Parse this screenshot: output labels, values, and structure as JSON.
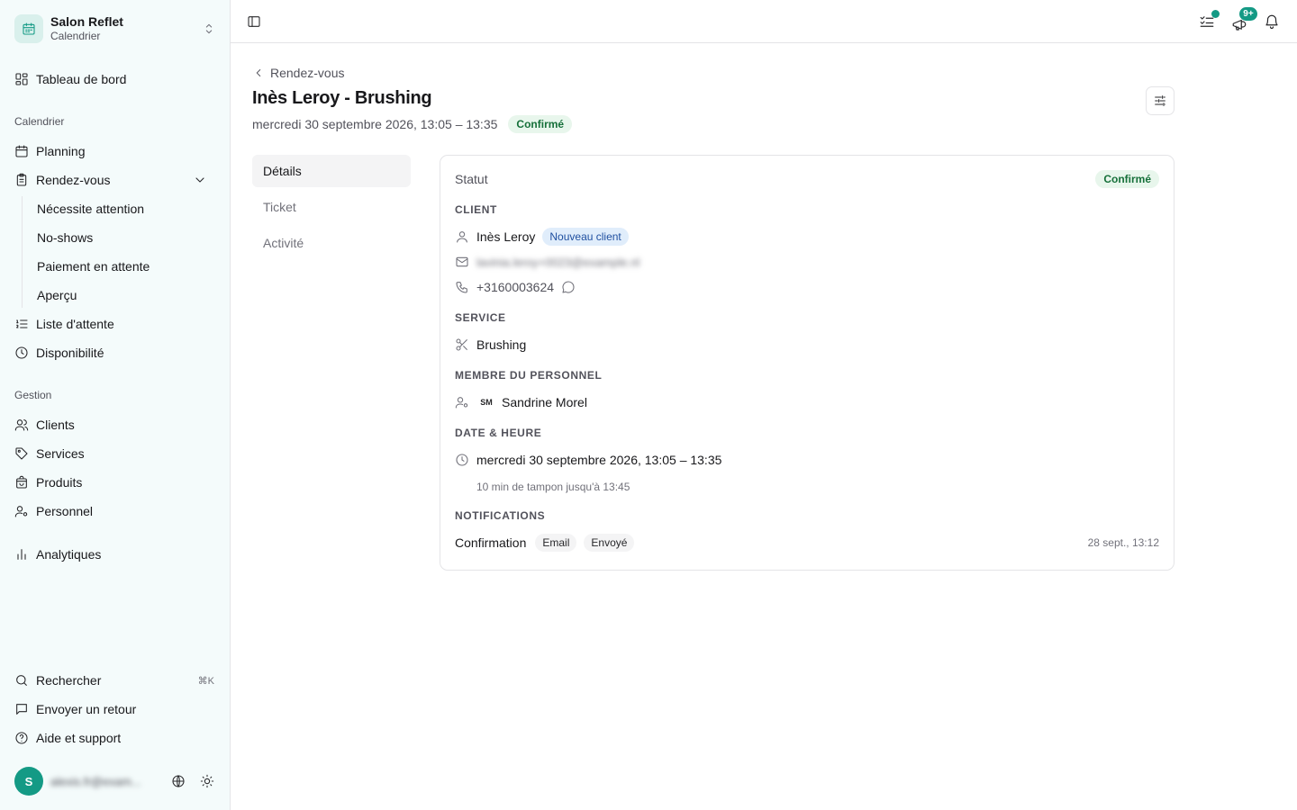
{
  "sidebar": {
    "brand": {
      "name": "Salon Reflet",
      "subtitle": "Calendrier",
      "logo_icon": "calendar-icon"
    },
    "dashboard_label": "Tableau de bord",
    "group_calendar": "Calendrier",
    "planning_label": "Planning",
    "appointments_label": "Rendez-vous",
    "appointments_sub": [
      "Nécessite attention",
      "No-shows",
      "Paiement en attente",
      "Aperçu"
    ],
    "waitlist_label": "Liste d'attente",
    "availability_label": "Disponibilité",
    "group_management": "Gestion",
    "clients_label": "Clients",
    "services_label": "Services",
    "products_label": "Produits",
    "staff_label": "Personnel",
    "analytics_label": "Analytiques",
    "search_label": "Rechercher",
    "search_shortcut": "⌘K",
    "feedback_label": "Envoyer un retour",
    "help_label": "Aide et support",
    "user": {
      "initial": "S",
      "email": "alexis.fr@exam..."
    }
  },
  "topbar": {
    "tasks_badge_color": "#149a85",
    "promo_badge": "9+"
  },
  "page": {
    "breadcrumb": "Rendez-vous",
    "title": "Inès Leroy - Brushing",
    "datetime": "mercredi 30 septembre 2026, 13:05 – 13:35",
    "status": "Confirmé"
  },
  "tabs": [
    "Détails",
    "Ticket",
    "Activité"
  ],
  "details": {
    "status_label": "Statut",
    "status_value": "Confirmé",
    "client_heading": "Client",
    "client_name": "Inès Leroy",
    "client_badge": "Nouveau client",
    "client_email": "lavinia.leroy+0023@example.nl",
    "client_phone": "+3160003624",
    "service_heading": "Service",
    "service_name": "Brushing",
    "staff_heading": "Membre du personnel",
    "staff_initials": "SM",
    "staff_name": "Sandrine Morel",
    "datetime_heading": "Date & heure",
    "datetime_value": "mercredi 30 septembre 2026, 13:05 – 13:35",
    "buffer_note": "10 min de tampon jusqu'à 13:45",
    "notifications_heading": "Notifications",
    "notification": {
      "type": "Confirmation",
      "channel": "Email",
      "state": "Envoyé",
      "time": "28 sept., 13:12"
    }
  },
  "colors": {
    "accent": "#149a85",
    "sidebar_bg": "#f4fbfb",
    "confirmed_bg": "#e8f6ec",
    "confirmed_text": "#16703a",
    "new_client_bg": "#e0edfb"
  }
}
